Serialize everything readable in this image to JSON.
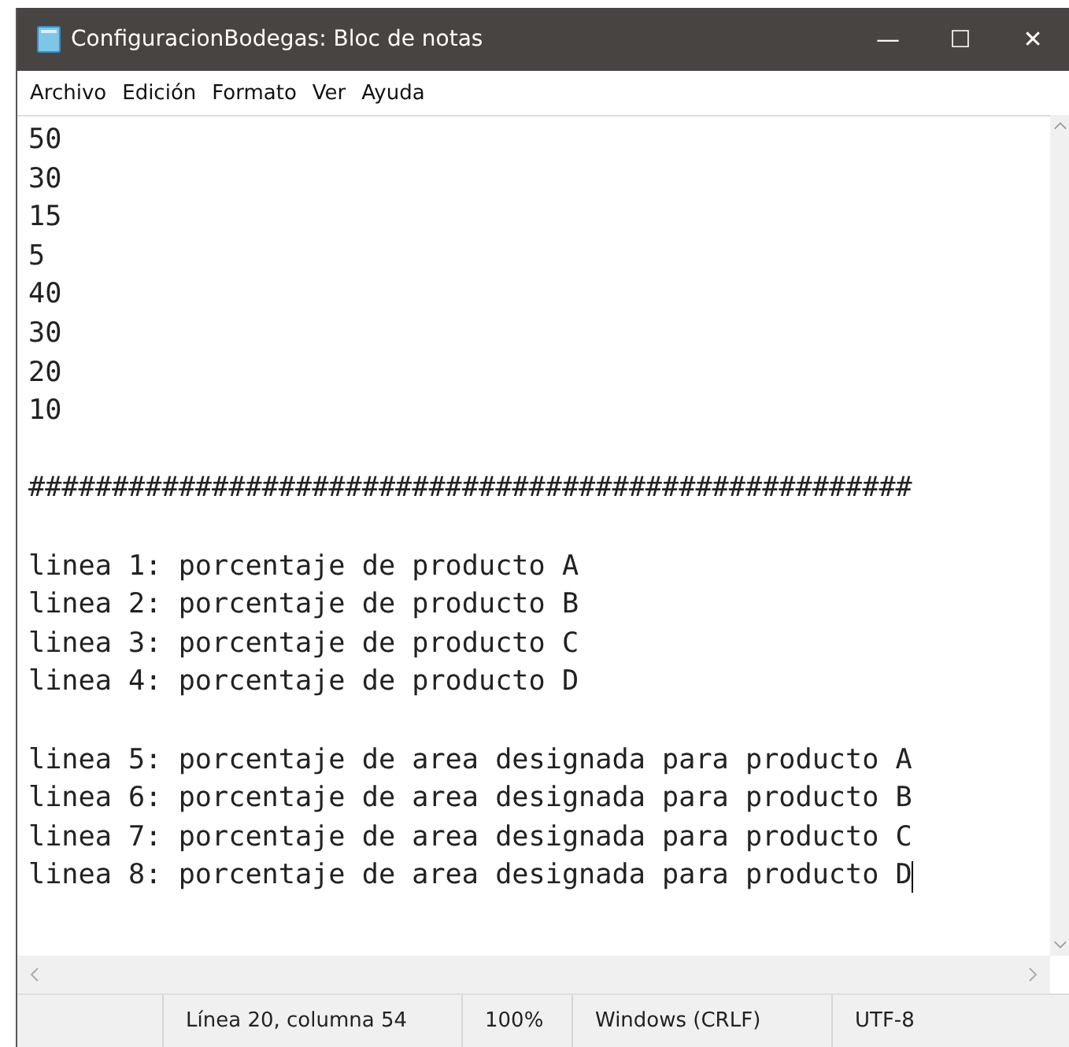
{
  "window": {
    "title": "ConfiguracionBodegas: Bloc de notas",
    "controls": [
      "—",
      "☐",
      "✕"
    ]
  },
  "menu": [
    "Archivo",
    "Edición",
    "Formato",
    "Ver",
    "Ayuda"
  ],
  "editor": {
    "blocks": [
      [
        "50",
        "30",
        "15",
        "5",
        "40",
        "30",
        "20",
        "10"
      ],
      [
        "#####################################################"
      ],
      [
        "linea 1: porcentaje de producto A",
        "linea 2: porcentaje de producto B",
        "linea 3: porcentaje de producto C",
        "linea 4: porcentaje de producto D"
      ],
      [
        "linea 5: porcentaje de area designada para producto A",
        "linea 6: porcentaje de area designada para producto B",
        "linea 7: porcentaje de area designada para producto C",
        "linea 8: porcentaje de area designada para producto D"
      ]
    ]
  },
  "status_bar": [
    "Línea 20, columna 54",
    "100%",
    "Windows (CRLF)",
    "UTF-8"
  ]
}
